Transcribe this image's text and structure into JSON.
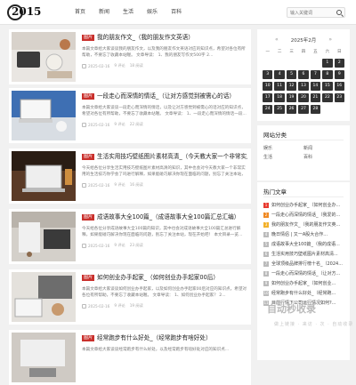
{
  "logo": {
    "text": "2015"
  },
  "nav": [
    "首页",
    "新闻",
    "生活",
    "娱乐",
    "百科"
  ],
  "search": {
    "placeholder": "输入关键词"
  },
  "posts": [
    {
      "category": "图片",
      "title": "我的朋友作文_（我的朋友作文英语）",
      "excerpt": "本篇文章给大家谈谈我的朋友作文，以及我的朋友作文英语对应的知识点，希望对各位有所帮助，不要忘了收藏本站喔。 文章导读： 1、我的朋友写作文500字 2...",
      "date": "2025-02-16",
      "views": "9 评论",
      "reads": "18 阅读"
    },
    {
      "category": "图片",
      "title": "一段走心而深情的情话_（让对方感觉到被需心的话）",
      "excerpt": "本篇文章给大家谈谈一段走心而深情的情话，以及让对方感觉到被需心的话对应的知识点，希望对各位有所帮助，不要忘了收藏本站喔。 文章导读： 1、一段走心而深情的情话一段...",
      "date": "2025-02-16",
      "views": "9 评论",
      "reads": "22 阅读"
    },
    {
      "category": "图片",
      "title": "生活实用技巧壁纸图片素材高清_（今天教大家一个非常实用的生活...",
      "excerpt": "今天给各位分享生活实用技巧壁纸图片素材高清的知识，其中也会对今天教大家一个非常实用的生活技巧你学会了吗进行解释，如果能碰巧解决你现在面临的问题，别忘了关注本站，现在开始吧...",
      "date": "2025-02-16",
      "views": "9 评论",
      "reads": "16 阅读"
    },
    {
      "category": "图片",
      "title": "成语故事大全100篇_（成语故事大全100篇汇总汇编）",
      "excerpt": "今天给各位分享成语故事大全100篇的知识，其中也会对成语故事大全100篇汇总进行解释，如果能碰巧解决你现在面临的问题，别忘了关注本站，现在开始吧！ 本文目录一览...",
      "date": "2025-02-16",
      "views": "9 评论",
      "reads": "23 阅读"
    },
    {
      "category": "图片",
      "title": "如何创业办手起家_（如何创业办手起家00后）",
      "excerpt": "本篇文章给大家谈谈如何创业办手起家，以及如何创业办手起家00后对应的知识点，希望对各位有所帮助，不要忘了收藏本站喔。 文章导读： 1、如何创业办手起家？ 2...",
      "date": "2025-02-16",
      "views": "9 评论",
      "reads": "19 阅读"
    },
    {
      "category": "图片",
      "title": "经常跑步有什么好处_（经常跑步有啥好处）",
      "excerpt": "本篇文章给大家谈谈经常跑步有什么好处，以及经常跑步有啥好处对应的知识点...",
      "date": "2025-02-16",
      "views": "9 评论",
      "reads": "20 阅读"
    }
  ],
  "calendar": {
    "title": "2025年2月",
    "prev": "«",
    "next": "»",
    "weekdays": [
      "一",
      "二",
      "三",
      "四",
      "五",
      "六",
      "日"
    ],
    "days": [
      "",
      "",
      "",
      "",
      "",
      "1",
      "2",
      "3",
      "4",
      "5",
      "6",
      "7",
      "8",
      "9",
      "10",
      "11",
      "12",
      "13",
      "14",
      "15",
      "16",
      "17",
      "18",
      "19",
      "20",
      "21",
      "22",
      "23",
      "24",
      "25",
      "26",
      "27",
      "28"
    ]
  },
  "categories_widget": {
    "title": "网站分类",
    "items": [
      "娱乐",
      "新闻",
      "生活",
      "百科"
    ]
  },
  "hot_widget": {
    "title": "热门文章",
    "items": [
      {
        "num": "1",
        "text": "如何创业办手起家_（如何创业办..."
      },
      {
        "num": "2",
        "text": "一段走心而深情的情话_（我爱的..."
      },
      {
        "num": "3",
        "text": "我的朋友作文_（我的朋友作文英..."
      },
      {
        "num": "4",
        "text": "晚日情侣 | 又一A股大合作..."
      },
      {
        "num": "5",
        "text": "成语故事大全100篇_（我的成语..."
      },
      {
        "num": "6",
        "text": "生活实用技巧壁纸图片素材高清..."
      },
      {
        "num": "7",
        "text": "全球顶级品牌排行榜十名_（2024..."
      },
      {
        "num": "8",
        "text": "一段走心而深情的情话_（让对方..."
      },
      {
        "num": "9",
        "text": "如何创业办手起家_（如何创业..."
      },
      {
        "num": "10",
        "text": "经常跑步有什么好处_（经常跑..."
      },
      {
        "num": "11",
        "text": "目前行情下公司运行情况如何?..."
      }
    ]
  },
  "watermark": {
    "logo": "自动秒收录",
    "sub": "做上链接 · 来访 · 次 · 自动收录"
  },
  "colors": {
    "accent": "#c9302c",
    "background": "#f1f1f1",
    "calendar_day": "#333333"
  }
}
